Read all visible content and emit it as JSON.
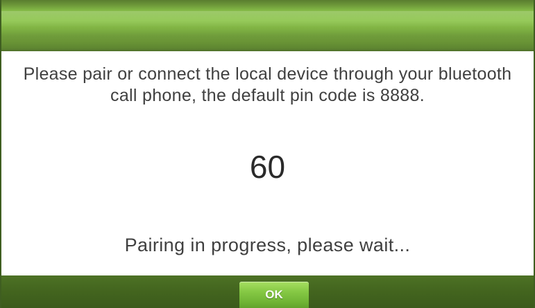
{
  "dialog": {
    "message": "Please pair or connect the local device through your bluetooth call phone, the default pin code is 8888.",
    "countdown": "60",
    "status": "Pairing in progress, please wait...",
    "ok_label": "OK"
  },
  "colors": {
    "title_bar": "#87bd49",
    "footer_bar": "#44661f",
    "ok_button": "#86c945",
    "text": "#404040"
  }
}
